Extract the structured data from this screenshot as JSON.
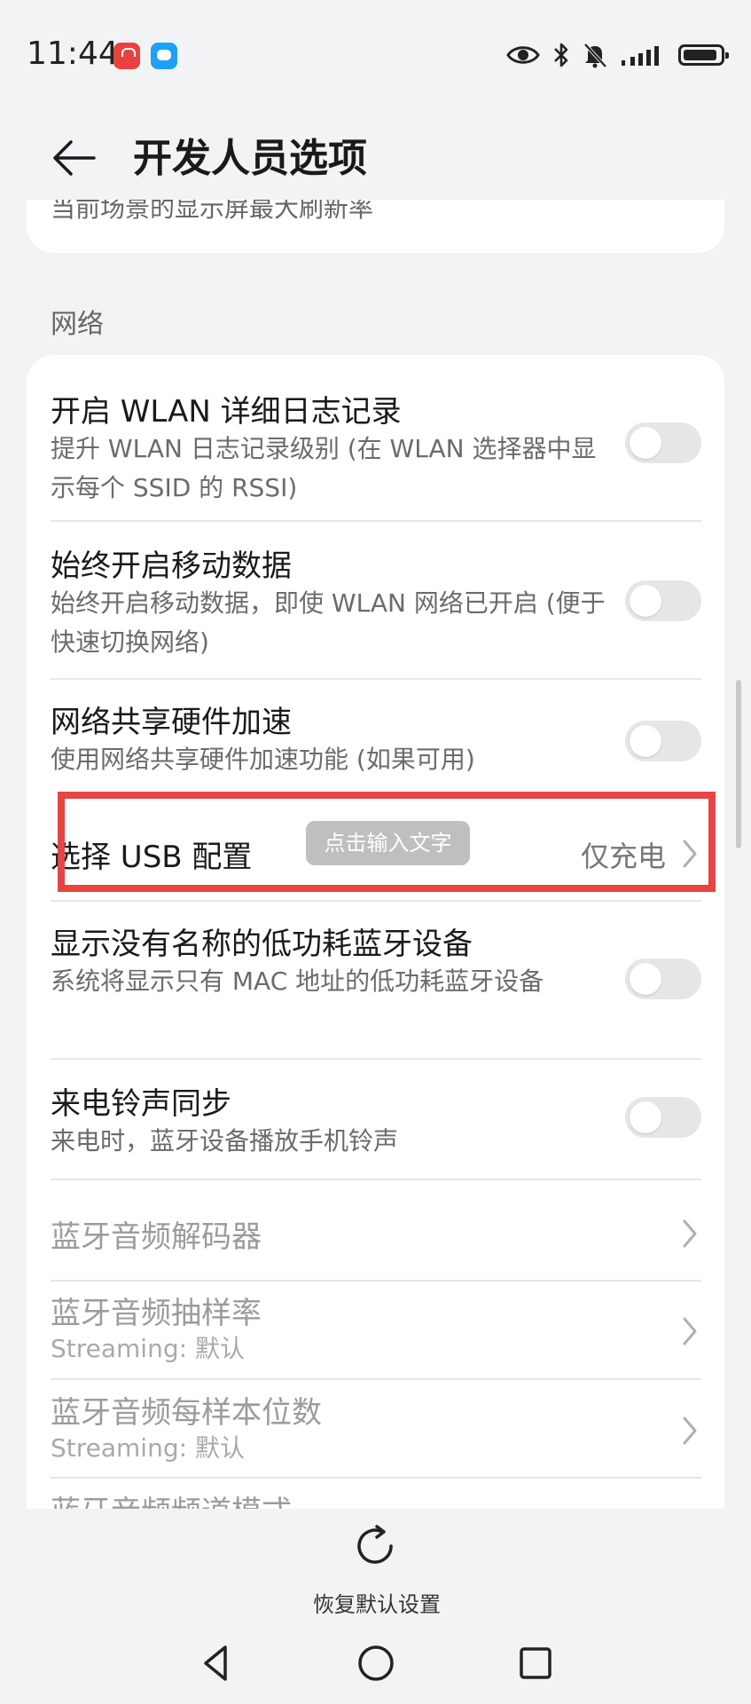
{
  "status_bar": {
    "time": "11:44",
    "icons": [
      "huawei-app-icon",
      "message-icon",
      "eye-icon",
      "bluetooth-icon",
      "mute-bell-icon",
      "signal-icon",
      "battery-icon"
    ]
  },
  "header": {
    "title": "开发人员选项"
  },
  "top_card": {
    "partial_text": "当前场景的显示屏最大刷新率"
  },
  "section": {
    "label": "网络"
  },
  "rows": [
    {
      "title": "开启 WLAN 详细日志记录",
      "subtitle": "提升 WLAN 日志记录级别 (在 WLAN 选择器中显示每个 SSID 的 RSSI)",
      "control": "toggle",
      "on": false
    },
    {
      "title": "始终开启移动数据",
      "subtitle": "始终开启移动数据，即使 WLAN 网络已开启 (便于快速切换网络)",
      "control": "toggle",
      "on": false
    },
    {
      "title": "网络共享硬件加速",
      "subtitle": "使用网络共享硬件加速功能 (如果可用)",
      "control": "toggle",
      "on": false
    },
    {
      "title": "选择 USB 配置",
      "value": "仅充电",
      "control": "chevron"
    },
    {
      "title": "显示没有名称的低功耗蓝牙设备",
      "subtitle": "系统将显示只有 MAC 地址的低功耗蓝牙设备",
      "control": "toggle",
      "on": false
    },
    {
      "title": "来电铃声同步",
      "subtitle": "来电时，蓝牙设备播放手机铃声",
      "control": "toggle",
      "on": false
    },
    {
      "title": "蓝牙音频解码器",
      "control": "chevron",
      "disabled": true
    },
    {
      "title": "蓝牙音频抽样率",
      "subtitle": "Streaming: 默认",
      "control": "chevron",
      "disabled": true
    },
    {
      "title": "蓝牙音频每样本位数",
      "subtitle": "Streaming: 默认",
      "control": "chevron",
      "disabled": true
    },
    {
      "title": "蓝牙音频频道模式",
      "control": "chevron",
      "disabled": true
    }
  ],
  "overlay": {
    "hint": "点击输入文字"
  },
  "bottom": {
    "reset_label": "恢复默认设置"
  },
  "colors": {
    "background": "#f1f3f5",
    "card": "#ffffff",
    "highlight": "#e74444",
    "toggle_off": "#e6e6e6"
  }
}
